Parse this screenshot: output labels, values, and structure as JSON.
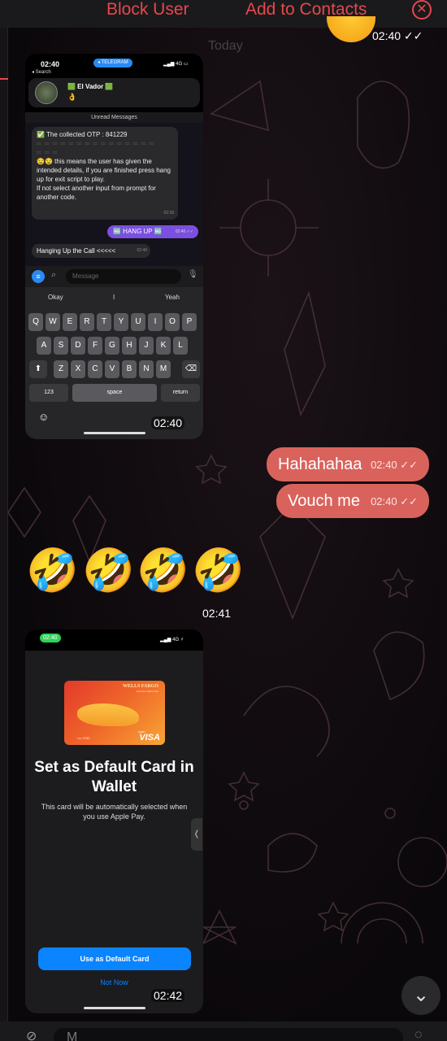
{
  "header": {
    "block_user": "Block User",
    "add_contacts": "Add to Contacts",
    "close_symbol": "✕"
  },
  "chat": {
    "date_label": "Today",
    "top_time": "02:40 ✓✓"
  },
  "screenshot1": {
    "status_time": "02:40",
    "search_back": "◂ Search",
    "app_pill": "◂ TELEGRAM",
    "signal": "▂▄▆ 4G ▭",
    "contact_name": "🟩 El Vador 🟩",
    "contact_emoji": "👌",
    "unread_label": "Unread Messages",
    "otp_line": "✅ The collected OTP :  841229",
    "separator": "═ ═ ═ ═ ═ ═ ═ ═ ═ ═ ═ ═ ═ ═ ═",
    "separator2": "═ ═ ═",
    "body_text": "🤤🤤 this means the user has given the intended details, if you are finished press hang up for exit script to play.",
    "body_text2": "If not select another input from prompt for another code.",
    "msg1_time": "02:39",
    "hangup_label": "🆖 HANG UP 🆖",
    "hangup_time": "02:40 ✓✓",
    "hanging_up_text": "Hanging Up the Call <<<<<",
    "hanging_up_time": "02:40",
    "message_placeholder": "Message",
    "suggestions": [
      "Okay",
      "I",
      "Yeah"
    ],
    "keys_row1": [
      "Q",
      "W",
      "E",
      "R",
      "T",
      "Y",
      "U",
      "I",
      "O",
      "P"
    ],
    "keys_row2": [
      "A",
      "S",
      "D",
      "F",
      "G",
      "H",
      "J",
      "K",
      "L"
    ],
    "keys_row3": [
      "Z",
      "X",
      "C",
      "V",
      "B",
      "N",
      "M"
    ],
    "key_shift": "⬆",
    "key_delete": "⌫",
    "key_123": "123",
    "key_space": "space",
    "key_return": "return",
    "key_emoji": "☺",
    "timestamp": "02:40"
  },
  "messages_out": [
    {
      "text": "Hahahahaa",
      "time": "02:40 ✓✓"
    },
    {
      "text": "Vouch me",
      "time": "02:40 ✓✓"
    }
  ],
  "emoji_message": {
    "emojis": [
      "🤣",
      "🤣",
      "🤣",
      "🤣"
    ],
    "time": "02:41"
  },
  "screenshot2": {
    "status_time": "02:40",
    "signal": "▂▄▆ 4G ⚡",
    "card_brand": "WELLS FARGO",
    "card_sub": "Premium Debit Card",
    "card_number": "•••• 9750",
    "card_debit": "DEBIT",
    "card_network": "VISA",
    "title": "Set as Default Card in Wallet",
    "description": "This card will be automatically selected when you use Apple Pay.",
    "handle": "❬",
    "primary_button": "Use as Default Card",
    "secondary_link": "Not Now",
    "timestamp": "02:42"
  },
  "controls": {
    "scroll_down": "⌄"
  },
  "composer": {
    "placeholder": "M",
    "left_icon": "⊘",
    "right_icon": "◌"
  },
  "colors": {
    "accent_red": "#e5484d",
    "bubble_out": "#d9635c",
    "telegram_blue": "#2a8af5",
    "ios_blue": "#0a84ff"
  }
}
